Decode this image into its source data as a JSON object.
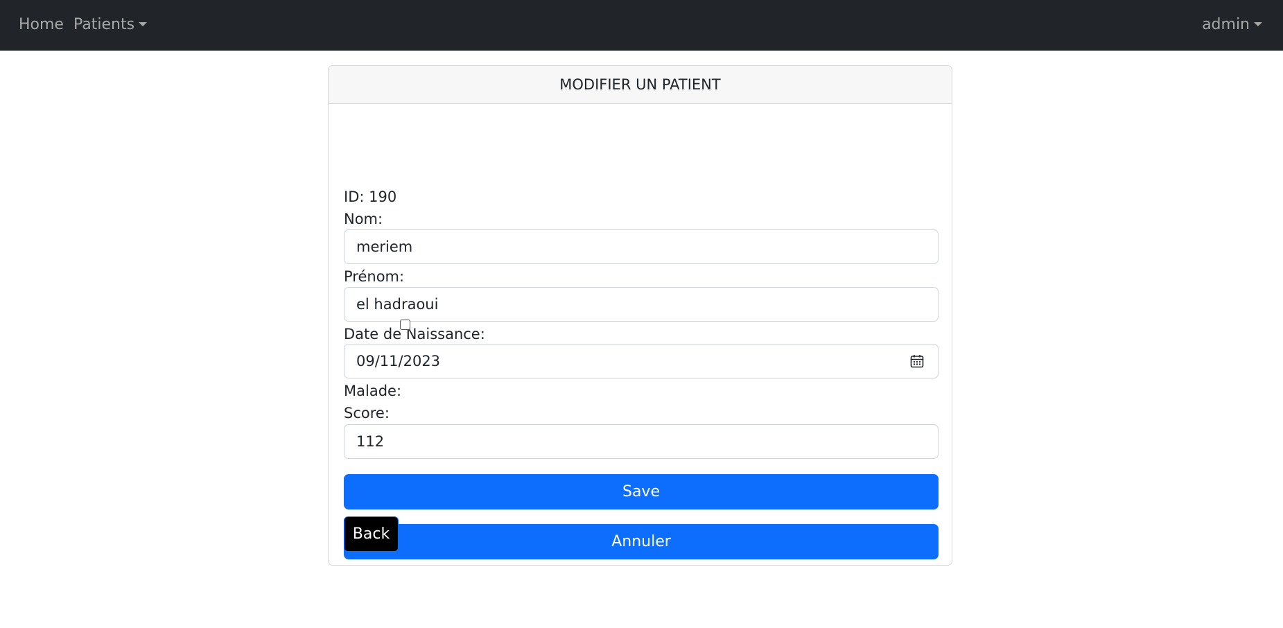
{
  "navbar": {
    "home_label": "Home",
    "patients_label": "Patients",
    "user_label": "admin"
  },
  "card": {
    "title": "MODIFIER UN PATIENT",
    "id_text": "ID: 190",
    "nom_label": "Nom:",
    "nom_value": "meriem",
    "prenom_label": "Prénom:",
    "prenom_value": "el hadraoui",
    "date_label": "Date de Naissance:",
    "date_value": "09/11/2023",
    "malade_label": "Malade:",
    "malade_checked": false,
    "score_label": "Score:",
    "score_value": "112",
    "save_label": "Save",
    "cancel_label": "Annuler",
    "back_label": "Back"
  },
  "colors": {
    "navbar_bg": "#212529",
    "primary": "#0d6efd",
    "back_bg": "#000000"
  },
  "icons": {
    "date_picker": "calendar-icon",
    "dropdown": "caret-down-icon"
  }
}
